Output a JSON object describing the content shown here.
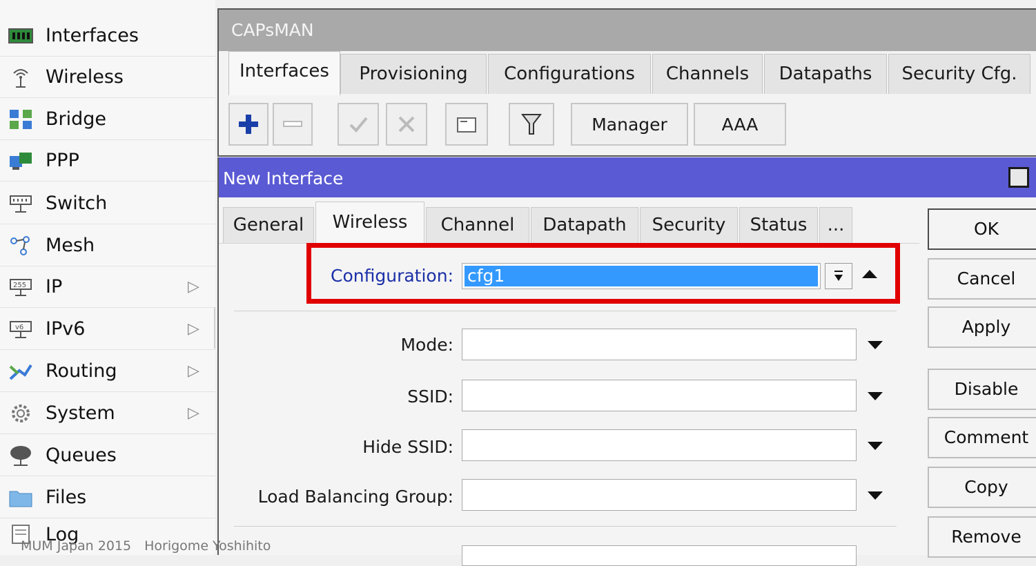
{
  "sidebar": {
    "items": [
      {
        "label": "Interfaces",
        "icon": "interfaces-icon",
        "submenu": false
      },
      {
        "label": "Wireless",
        "icon": "wireless-icon",
        "submenu": false
      },
      {
        "label": "Bridge",
        "icon": "bridge-icon",
        "submenu": false
      },
      {
        "label": "PPP",
        "icon": "ppp-icon",
        "submenu": false
      },
      {
        "label": "Switch",
        "icon": "switch-icon",
        "submenu": false
      },
      {
        "label": "Mesh",
        "icon": "mesh-icon",
        "submenu": false
      },
      {
        "label": "IP",
        "icon": "ip-icon",
        "submenu": true
      },
      {
        "label": "IPv6",
        "icon": "ipv6-icon",
        "submenu": true
      },
      {
        "label": "Routing",
        "icon": "routing-icon",
        "submenu": true
      },
      {
        "label": "System",
        "icon": "system-icon",
        "submenu": true
      },
      {
        "label": "Queues",
        "icon": "queues-icon",
        "submenu": false
      },
      {
        "label": "Files",
        "icon": "files-icon",
        "submenu": false
      },
      {
        "label": "Log",
        "icon": "log-icon",
        "submenu": false
      }
    ]
  },
  "capsman": {
    "title": "CAPsMAN",
    "tabs": [
      "Interfaces",
      "Provisioning",
      "Configurations",
      "Channels",
      "Datapaths",
      "Security Cfg."
    ],
    "active_tab": "Interfaces",
    "toolbar": {
      "manager_label": "Manager",
      "aaa_label": "AAA"
    }
  },
  "dialog": {
    "title": "New Interface",
    "tabs": [
      "General",
      "Wireless",
      "Channel",
      "Datapath",
      "Security",
      "Status",
      "..."
    ],
    "active_tab": "Wireless",
    "configuration": {
      "label": "Configuration:",
      "value": "cfg1"
    },
    "fields": [
      {
        "label": "Mode:",
        "value": ""
      },
      {
        "label": "SSID:",
        "value": ""
      },
      {
        "label": "Hide SSID:",
        "value": ""
      },
      {
        "label": "Load Balancing Group:",
        "value": ""
      }
    ],
    "buttons": [
      "OK",
      "Cancel",
      "Apply",
      "Disable",
      "Comment",
      "Copy",
      "Remove"
    ]
  },
  "footer": {
    "text": "MUM Japan 2015　Horigome Yoshihito"
  },
  "colors": {
    "dialog_title_bg": "#5a5ad4",
    "capsman_title_bg": "#a9a9a9",
    "highlight_border": "#e00000",
    "selection_bg": "#3399ff",
    "add_icon": "#1b3fa8"
  }
}
